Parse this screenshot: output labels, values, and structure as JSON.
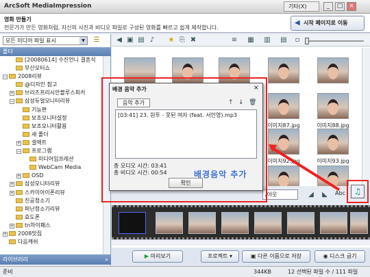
{
  "app": {
    "title": "ArcSoft MediaImpression",
    "etc_menu": "기타(X)",
    "min": "_",
    "max": "□",
    "close": "×"
  },
  "header": {
    "title": "영화 만들기",
    "subtitle": "전문가가 만든 영화처럼, 자신의 사진과 비디오 파일로 구성된 영화를 빠르고 쉽게 제작합니다.",
    "back_button": "시작 페이지로 이동"
  },
  "left": {
    "filter_label": "모든 미디어 파일 표시",
    "folder_header": "폴더",
    "tree": [
      {
        "label": "[20080614] 수진언니 결혼식",
        "indent": 1,
        "pm": ""
      },
      {
        "label": "부산모터쇼",
        "indent": 1,
        "pm": ""
      },
      {
        "label": "2008리뷰",
        "indent": 0,
        "pm": "−"
      },
      {
        "label": "@디자인 참고",
        "indent": 1,
        "pm": ""
      },
      {
        "label": "브리츠프리시안블루스피커",
        "indent": 1,
        "pm": "+"
      },
      {
        "label": "삼성듀얼모니터리뷰",
        "indent": 1,
        "pm": "−"
      },
      {
        "label": "기능편",
        "indent": 2,
        "pm": ""
      },
      {
        "label": "보조모니터설정",
        "indent": 2,
        "pm": ""
      },
      {
        "label": "보조모니터활용",
        "indent": 2,
        "pm": ""
      },
      {
        "label": "새 폴더",
        "indent": 2,
        "pm": ""
      },
      {
        "label": "셀렉트",
        "indent": 2,
        "pm": "+"
      },
      {
        "label": "프로그램",
        "indent": 2,
        "pm": "−"
      },
      {
        "label": "미디어임프레션",
        "indent": 3,
        "pm": ""
      },
      {
        "label": "WebCam Media",
        "indent": 3,
        "pm": ""
      },
      {
        "label": "OSD",
        "indent": 2,
        "pm": "+"
      },
      {
        "label": "삼성모니터리뷰",
        "indent": 1,
        "pm": "+"
      },
      {
        "label": "스카이아이폰리뷰",
        "indent": 1,
        "pm": "+"
      },
      {
        "label": "진공청소기",
        "indent": 1,
        "pm": ""
      },
      {
        "label": "퍼난청소기리뷰",
        "indent": 1,
        "pm": ""
      },
      {
        "label": "효도폰",
        "indent": 1,
        "pm": ""
      },
      {
        "label": "tn하이패스",
        "indent": 1,
        "pm": "+"
      },
      {
        "label": "2008맛집",
        "indent": 0,
        "pm": "+"
      },
      {
        "label": "다음캐쉬",
        "indent": 0,
        "pm": ""
      }
    ],
    "library_label": "라이브러리"
  },
  "thumbs": {
    "labels": [
      "이미지87.jpg",
      "이미지88.jpg",
      "이미지92.jpg",
      "이미지93.jpg"
    ]
  },
  "dialog": {
    "title": "배경 음악 추가",
    "close": "×",
    "add_button": "음악 추가",
    "track": "[03:41] 23. 원투 - 못된 여자 (feat. 서인영).mp3",
    "total_audio": "총 오디오 시간: 03:41",
    "total_video": "총 비디오 시간: 00:54",
    "ok_button": "확인"
  },
  "callout": "배경음악 추가",
  "editbar": {
    "transition_select": "/아웃",
    "text_tool": "Abc"
  },
  "bottom": {
    "preview": "미리보기",
    "project": "프로젝트",
    "save_as": "다른 이름으로 저장",
    "burn": "디스크 굽기"
  },
  "status": {
    "left": "준비",
    "size": "344KB",
    "count": "12 선택된 파일 수 / 111 파일"
  }
}
